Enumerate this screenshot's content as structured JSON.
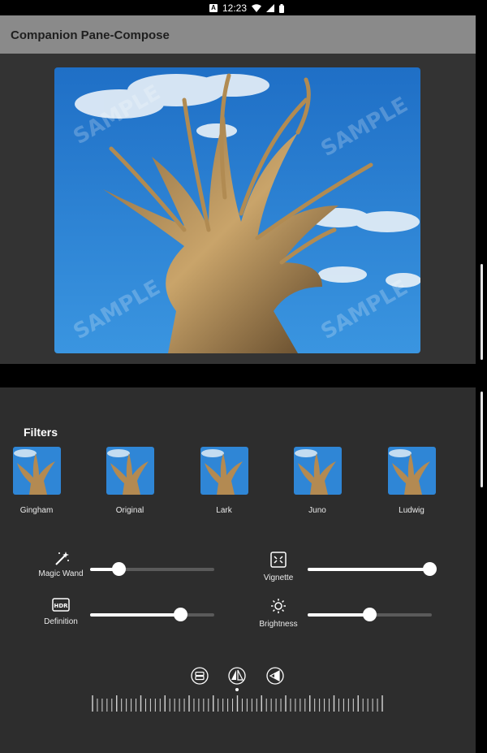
{
  "status_bar": {
    "time": "12:23",
    "notif_glyph": "A"
  },
  "app": {
    "title": "Companion Pane-Compose"
  },
  "photo": {
    "watermark": "SAMPLE",
    "sky_color": "#2f86d6"
  },
  "filters": {
    "title": "Filters",
    "items": [
      {
        "label": "Gingham"
      },
      {
        "label": "Original"
      },
      {
        "label": "Lark"
      },
      {
        "label": "Juno"
      },
      {
        "label": "Ludwig"
      }
    ]
  },
  "controls": [
    {
      "label": "Magic Wand",
      "icon": "magic-wand-icon",
      "value": 0.22
    },
    {
      "label": "Vignette",
      "icon": "vignette-icon",
      "value": 1.0
    },
    {
      "label": "Definition",
      "icon": "hdr-icon",
      "icon_text": "HDR",
      "value": 0.72
    },
    {
      "label": "Brightness",
      "icon": "brightness-icon",
      "value": 0.5
    }
  ],
  "modes": {
    "items": [
      {
        "icon": "layout-mode-icon"
      },
      {
        "icon": "sailboat-mode-icon",
        "selected": true
      },
      {
        "icon": "contrast-mode-icon"
      }
    ]
  },
  "colors": {
    "pane_top": "#333333",
    "pane_bottom": "#2d2d2d",
    "app_bar": "#8a8a8a",
    "accent": "#ffffff"
  }
}
